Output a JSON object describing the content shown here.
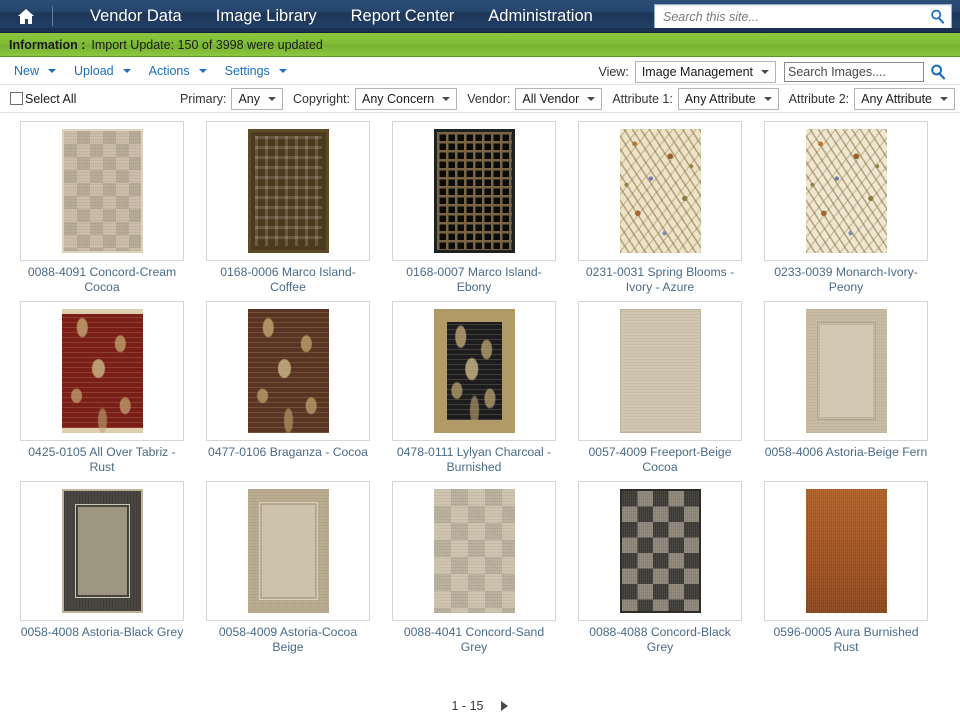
{
  "topnav": {
    "home_icon": "home-icon",
    "items": [
      {
        "label": "Vendor Data"
      },
      {
        "label": "Image Library"
      },
      {
        "label": "Report Center"
      },
      {
        "label": "Administration"
      }
    ],
    "search": {
      "placeholder": "Search this site...",
      "value": "",
      "icon": "search-icon"
    }
  },
  "info_bar": {
    "label": "Information :",
    "message": "Import Update: 150 of 3998 were updated",
    "color": "#8cc63f"
  },
  "command_bar": {
    "new_label": "New",
    "upload_label": "Upload",
    "actions_label": "Actions",
    "settings_label": "Settings",
    "view_label": "View:",
    "view_value": "Image Management",
    "search_images_placeholder": "Search Images....",
    "search_images_value": "",
    "search_images_icon": "search-icon"
  },
  "filter_bar": {
    "select_all_label": "Select All",
    "select_all_checked": false,
    "filters": [
      {
        "label": "Primary:",
        "value": "Any"
      },
      {
        "label": "Copyright:",
        "value": "Any Concern"
      },
      {
        "label": "Vendor:",
        "value": "All Vendor"
      },
      {
        "label": "Attribute 1:",
        "value": "Any Attribute"
      },
      {
        "label": "Attribute 2:",
        "value": "Any Attribute"
      }
    ]
  },
  "gallery": {
    "items": [
      {
        "caption": "0088-4091 Concord-Cream Cocoa",
        "style": "checker-cream"
      },
      {
        "caption": "0168-0006 Marco Island-Coffee",
        "style": "weave-coffee"
      },
      {
        "caption": "0168-0007 Marco Island-Ebony",
        "style": "weave-ebony"
      },
      {
        "caption": "0231-0031 Spring Blooms - Ivory - Azure",
        "style": "floral-ivory"
      },
      {
        "caption": "0233-0039 Monarch-Ivory-Peony",
        "style": "floral-peony"
      },
      {
        "caption": "0425-0105 All Over Tabriz - Rust",
        "style": "persian-rust"
      },
      {
        "caption": "0477-0106 Braganza - Cocoa",
        "style": "persian-cocoa"
      },
      {
        "caption": "0478-0111 Lylyan Charcoal - Burnished",
        "style": "persian-charcoal"
      },
      {
        "caption": "0057-4009 Freeport-Beige Cocoa",
        "style": "solid-beige"
      },
      {
        "caption": "0058-4006 Astoria-Beige Fern",
        "style": "border-beige"
      },
      {
        "caption": "0058-4008 Astoria-Black Grey",
        "style": "border-blackgrey"
      },
      {
        "caption": "0058-4009 Astoria-Cocoa Beige",
        "style": "border-cocoabeige"
      },
      {
        "caption": "0088-4041 Concord-Sand Grey",
        "style": "solid-sand"
      },
      {
        "caption": "0088-4088 Concord-Black Grey",
        "style": "checker-blackgrey"
      },
      {
        "caption": "0596-0005 Aura Burnished Rust",
        "style": "solid-rust"
      }
    ]
  },
  "pager": {
    "range": "1 - 15",
    "next_icon": "next-arrow-icon"
  }
}
